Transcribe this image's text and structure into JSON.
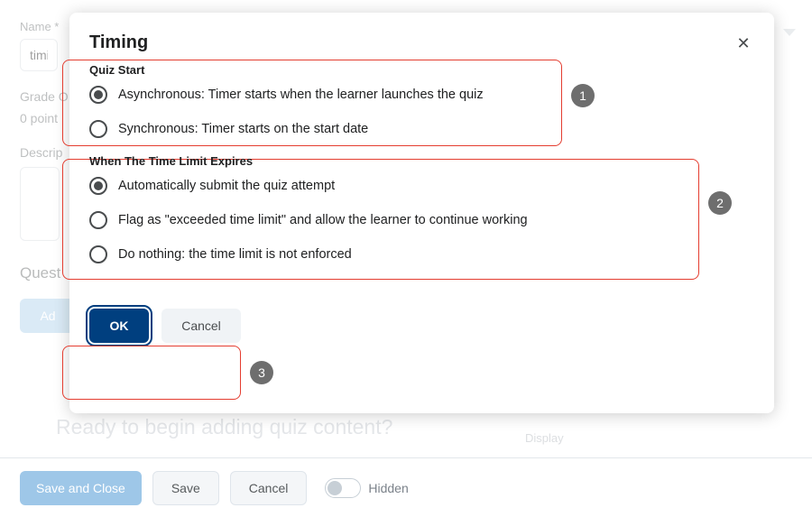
{
  "page": {
    "name_label": "Name *",
    "name_value": "timin",
    "grade_out_label": "Grade O",
    "points": "0 point",
    "description_label": "Descrip",
    "questions_heading": "Quest",
    "add_button": "Ad",
    "ready_text": "Ready to begin adding quiz content?",
    "display_label": "Display"
  },
  "footer": {
    "save_and_close": "Save and Close",
    "save": "Save",
    "cancel": "Cancel",
    "hidden": "Hidden"
  },
  "dialog": {
    "title": "Timing",
    "close_glyph": "✕",
    "quiz_start": {
      "title": "Quiz Start",
      "options": [
        {
          "label": "Asynchronous: Timer starts when the learner launches the quiz",
          "selected": true
        },
        {
          "label": "Synchronous: Timer starts on the start date",
          "selected": false
        }
      ]
    },
    "time_expires": {
      "title": "When The Time Limit Expires",
      "options": [
        {
          "label": "Automatically submit the quiz attempt",
          "selected": true
        },
        {
          "label": "Flag as \"exceeded time limit\" and allow the learner to continue working",
          "selected": false
        },
        {
          "label": "Do nothing: the time limit is not enforced",
          "selected": false
        }
      ]
    },
    "ok": "OK",
    "cancel": "Cancel",
    "badges": [
      "1",
      "2",
      "3"
    ]
  }
}
